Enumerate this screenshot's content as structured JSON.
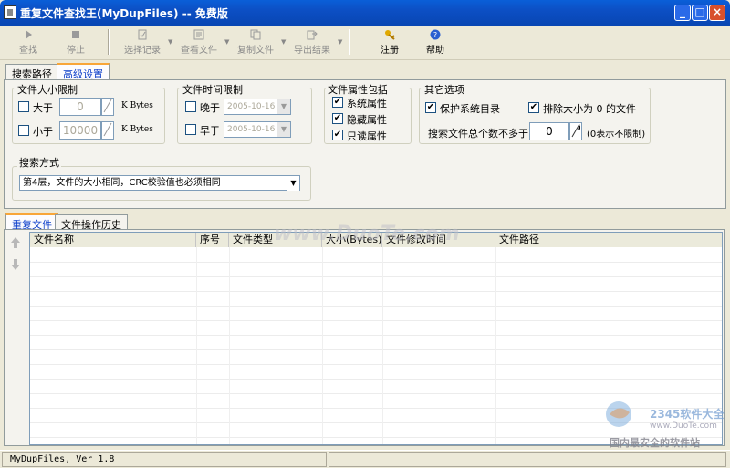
{
  "window": {
    "title": "重复文件查找王(MyDupFiles) -- 免费版",
    "min_label": "_",
    "max_label": "□",
    "close_label": "×"
  },
  "toolbar": {
    "search": "查找",
    "stop": "停止",
    "select_record": "选择记录",
    "view_file": "查看文件",
    "copy_file": "复制文件",
    "export_result": "导出结果",
    "register": "注册",
    "help": "帮助"
  },
  "tabs": {
    "search_path": "搜索路径",
    "advanced": "高级设置"
  },
  "size_limit": {
    "title": "文件大小限制",
    "greater_label": "大于",
    "greater_value": "0",
    "greater_unit": "K Bytes",
    "less_label": "小于",
    "less_value": "10000",
    "less_unit": "K Bytes"
  },
  "time_limit": {
    "title": "文件时间限制",
    "later_label": "晚于",
    "later_value": "2005-10-16",
    "earlier_label": "早于",
    "earlier_value": "2005-10-16"
  },
  "attributes": {
    "title": "文件属性包括",
    "system": "系统属性",
    "hidden": "隐藏属性",
    "readonly": "只读属性",
    "check": "✔"
  },
  "other": {
    "title": "其它选项",
    "protect": "保护系统目录",
    "exclude_zero": "排除大小为 0 的文件",
    "max_count_label": "搜索文件总个数不多于：",
    "max_count_value": "0",
    "max_count_hint": "(0表示不限制)"
  },
  "search_mode": {
    "title": "搜索方式",
    "value": "第4层，文件的大小相同，CRC校验值也必须相同"
  },
  "result_tabs": {
    "dup_files": "重复文件",
    "history": "文件操作历史"
  },
  "columns": [
    "文件名称",
    "序号",
    "文件类型",
    "大小(Bytes)",
    "文件修改时间",
    "文件路径"
  ],
  "status": {
    "version": "MyDupFiles, Ver 1.8"
  },
  "watermark": {
    "center": "www.DuoTe.com",
    "brand": "2345软件大全",
    "url": "www.DuoTe.com",
    "slogan": "国内最安全的软件站"
  }
}
